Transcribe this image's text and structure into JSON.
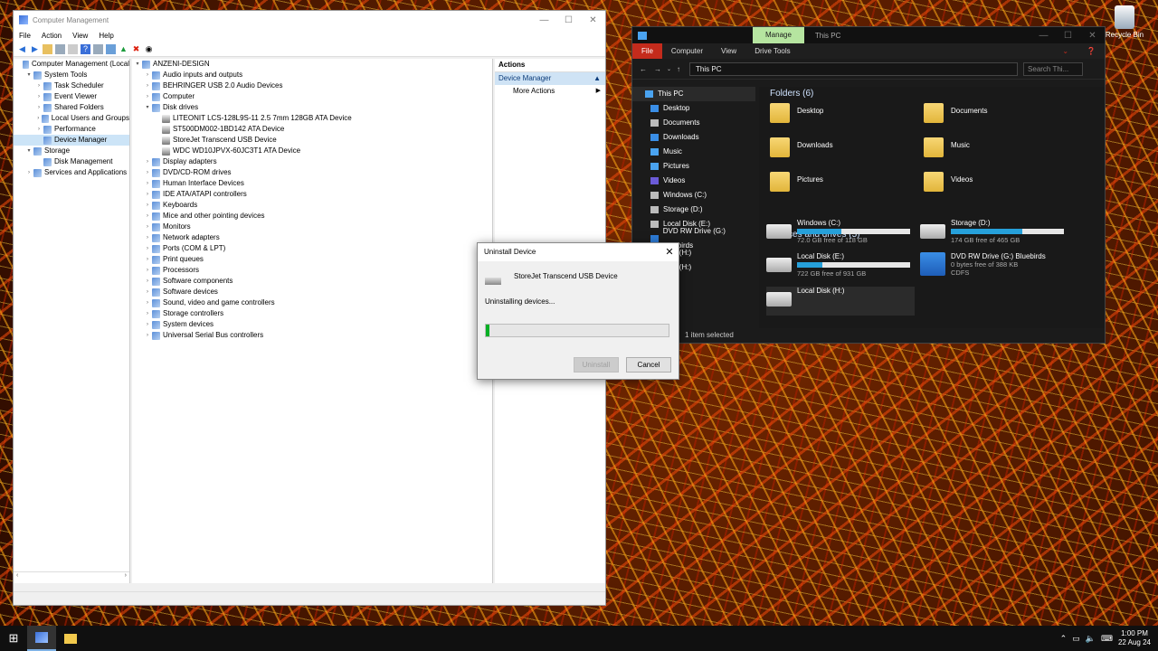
{
  "colors": {
    "accent": "#0078d7",
    "progress": "#06b025",
    "manage_tab": "#b6e5a0",
    "file_tab": "#c42b1c",
    "drive_bar": "#26a0da"
  },
  "computer_management": {
    "title": "Computer Management",
    "menu": [
      "File",
      "Action",
      "View",
      "Help"
    ],
    "tree": [
      {
        "label": "Computer Management (Local",
        "indent": 0,
        "icon": "computer-icon",
        "exp": ""
      },
      {
        "label": "System Tools",
        "indent": 1,
        "icon": "tools-icon",
        "exp": "▾"
      },
      {
        "label": "Task Scheduler",
        "indent": 2,
        "icon": "scheduler-icon",
        "exp": "›"
      },
      {
        "label": "Event Viewer",
        "indent": 2,
        "icon": "event-viewer-icon",
        "exp": "›"
      },
      {
        "label": "Shared Folders",
        "indent": 2,
        "icon": "shared-folder-icon",
        "exp": "›"
      },
      {
        "label": "Local Users and Groups",
        "indent": 2,
        "icon": "users-icon",
        "exp": "›"
      },
      {
        "label": "Performance",
        "indent": 2,
        "icon": "performance-icon",
        "exp": "›"
      },
      {
        "label": "Device Manager",
        "indent": 2,
        "icon": "device-manager-icon",
        "exp": "",
        "selected": true
      },
      {
        "label": "Storage",
        "indent": 1,
        "icon": "storage-icon",
        "exp": "▾"
      },
      {
        "label": "Disk Management",
        "indent": 2,
        "icon": "disk-management-icon",
        "exp": ""
      },
      {
        "label": "Services and Applications",
        "indent": 1,
        "icon": "services-icon",
        "exp": "›"
      }
    ],
    "devices": [
      {
        "label": "ANZENI-DESIGN",
        "indent": 0,
        "exp": "▾",
        "icon": "computer-icon"
      },
      {
        "label": "Audio inputs and outputs",
        "indent": 1,
        "exp": "›",
        "icon": "audio-icon"
      },
      {
        "label": "BEHRINGER USB 2.0 Audio Devices",
        "indent": 1,
        "exp": "›",
        "icon": "audio-device-icon"
      },
      {
        "label": "Computer",
        "indent": 1,
        "exp": "›",
        "icon": "computer-icon"
      },
      {
        "label": "Disk drives",
        "indent": 1,
        "exp": "▾",
        "icon": "disk-drive-icon"
      },
      {
        "label": "LITEONIT LCS-128L9S-11 2.5 7mm 128GB ATA Device",
        "indent": 2,
        "exp": "",
        "icon": "disk-icon"
      },
      {
        "label": "ST500DM002-1BD142 ATA Device",
        "indent": 2,
        "exp": "",
        "icon": "disk-icon"
      },
      {
        "label": "StoreJet Transcend USB Device",
        "indent": 2,
        "exp": "",
        "icon": "disk-icon"
      },
      {
        "label": "WDC WD10JPVX-60JC3T1 ATA Device",
        "indent": 2,
        "exp": "",
        "icon": "disk-icon"
      },
      {
        "label": "Display adapters",
        "indent": 1,
        "exp": "›",
        "icon": "display-adapter-icon"
      },
      {
        "label": "DVD/CD-ROM drives",
        "indent": 1,
        "exp": "›",
        "icon": "dvd-icon"
      },
      {
        "label": "Human Interface Devices",
        "indent": 1,
        "exp": "›",
        "icon": "hid-icon"
      },
      {
        "label": "IDE ATA/ATAPI controllers",
        "indent": 1,
        "exp": "›",
        "icon": "ide-icon"
      },
      {
        "label": "Keyboards",
        "indent": 1,
        "exp": "›",
        "icon": "keyboard-icon"
      },
      {
        "label": "Mice and other pointing devices",
        "indent": 1,
        "exp": "›",
        "icon": "mouse-icon"
      },
      {
        "label": "Monitors",
        "indent": 1,
        "exp": "›",
        "icon": "monitor-icon"
      },
      {
        "label": "Network adapters",
        "indent": 1,
        "exp": "›",
        "icon": "network-icon"
      },
      {
        "label": "Ports (COM & LPT)",
        "indent": 1,
        "exp": "›",
        "icon": "port-icon"
      },
      {
        "label": "Print queues",
        "indent": 1,
        "exp": "›",
        "icon": "printer-icon"
      },
      {
        "label": "Processors",
        "indent": 1,
        "exp": "›",
        "icon": "processor-icon"
      },
      {
        "label": "Software components",
        "indent": 1,
        "exp": "›",
        "icon": "software-component-icon"
      },
      {
        "label": "Software devices",
        "indent": 1,
        "exp": "›",
        "icon": "software-device-icon"
      },
      {
        "label": "Sound, video and game controllers",
        "indent": 1,
        "exp": "›",
        "icon": "sound-icon"
      },
      {
        "label": "Storage controllers",
        "indent": 1,
        "exp": "›",
        "icon": "storage-controller-icon"
      },
      {
        "label": "System devices",
        "indent": 1,
        "exp": "›",
        "icon": "system-device-icon"
      },
      {
        "label": "Universal Serial Bus controllers",
        "indent": 1,
        "exp": "›",
        "icon": "usb-icon"
      }
    ],
    "actions": {
      "header": "Actions",
      "selected": "Device Manager",
      "more": "More Actions"
    }
  },
  "explorer": {
    "manage_tab": "Manage",
    "title": "This PC",
    "ribbon": [
      "File",
      "Computer",
      "View",
      "Drive Tools"
    ],
    "address": "This PC",
    "search_placeholder": "Search Thi...",
    "nav": [
      {
        "label": "This PC",
        "color": "#4aa3f0"
      },
      {
        "label": "Desktop",
        "color": "#3a8ee6"
      },
      {
        "label": "Documents",
        "color": "#bbbbbb"
      },
      {
        "label": "Downloads",
        "color": "#3a8ee6"
      },
      {
        "label": "Music",
        "color": "#4aa3f0"
      },
      {
        "label": "Pictures",
        "color": "#4aa3f0"
      },
      {
        "label": "Videos",
        "color": "#6b5bd8"
      },
      {
        "label": "Windows (C:)",
        "color": "#bbbbbb"
      },
      {
        "label": "Storage (D:)",
        "color": "#bbbbbb"
      },
      {
        "label": "Local Disk (E:)",
        "color": "#bbbbbb"
      },
      {
        "label": "DVD RW Drive (G:) Bluebirds",
        "color": "#2d7bd6"
      },
      {
        "label": "Disk (H:)",
        "color": "#bbbbbb"
      },
      {
        "label": "Disk (H:)",
        "color": "#bbbbbb"
      },
      {
        "label": "rk",
        "color": "#bbbbbb"
      }
    ],
    "folders_header": "Folders (6)",
    "folders": [
      "Desktop",
      "Documents",
      "Downloads",
      "Music",
      "Pictures",
      "Videos"
    ],
    "drives_header": "Devices and drives (5)",
    "drives": [
      {
        "name": "Windows (C:)",
        "info": "72.0 GB free of 118 GB",
        "used_fraction": 0.39
      },
      {
        "name": "Storage (D:)",
        "info": "174 GB free of 465 GB",
        "used_fraction": 0.63
      },
      {
        "name": "Local Disk (E:)",
        "info": "722 GB free of 931 GB",
        "used_fraction": 0.22
      },
      {
        "name": "DVD RW Drive (G:) Bluebirds",
        "info": "0 bytes free of 388 KB",
        "extra": "CDFS"
      },
      {
        "name": "Local Disk (H:)",
        "info": ""
      }
    ],
    "status": "1 item selected"
  },
  "dialog": {
    "title": "Uninstall Device",
    "device": "StoreJet Transcend USB Device",
    "message": "Uninstalling devices...",
    "progress": 0.02,
    "uninstall": "Uninstall",
    "cancel": "Cancel"
  },
  "desktop": {
    "recycle_bin": "Recycle Bin"
  },
  "taskbar": {
    "time": "1:00 PM",
    "date": "22 Aug 24"
  }
}
